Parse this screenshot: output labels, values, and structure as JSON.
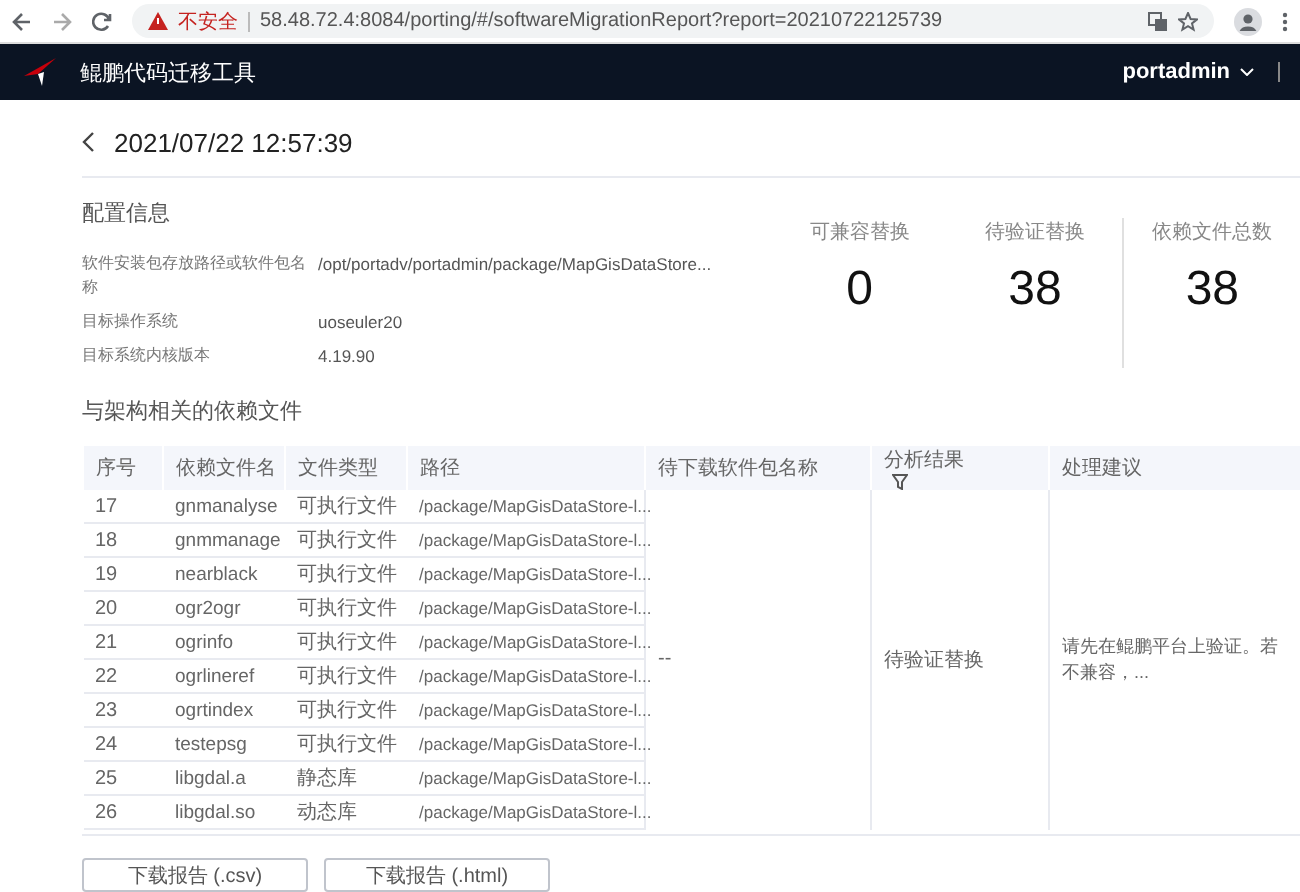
{
  "browser": {
    "security_label": "不安全",
    "url": "58.48.72.4:8084/porting/#/softwareMigrationReport?report=20210722125739"
  },
  "header": {
    "product_name": "鲲鹏代码迁移工具",
    "user": "portadmin"
  },
  "report": {
    "title": "2021/07/22 12:57:39"
  },
  "config": {
    "heading": "配置信息",
    "fields": [
      {
        "label": "软件安装包存放路径或软件包名称",
        "value": "/opt/portadv/portadmin/package/MapGisDataStore..."
      },
      {
        "label": "目标操作系统",
        "value": "uoseuler20"
      },
      {
        "label": "目标系统内核版本",
        "value": "4.19.90"
      }
    ]
  },
  "stats": [
    {
      "label": "可兼容替换",
      "value": "0"
    },
    {
      "label": "待验证替换",
      "value": "38"
    },
    {
      "label": "依赖文件总数",
      "value": "38"
    }
  ],
  "table": {
    "heading": "与架构相关的依赖文件",
    "columns": [
      "序号",
      "依赖文件名",
      "文件类型",
      "路径",
      "待下载软件包名称",
      "分析结果",
      "处理建议"
    ],
    "rows": [
      {
        "index": "17",
        "name": "gnmanalyse",
        "type": "可执行文件",
        "path": "/package/MapGisDataStore-l..."
      },
      {
        "index": "18",
        "name": "gnmmanage",
        "type": "可执行文件",
        "path": "/package/MapGisDataStore-l..."
      },
      {
        "index": "19",
        "name": "nearblack",
        "type": "可执行文件",
        "path": "/package/MapGisDataStore-l..."
      },
      {
        "index": "20",
        "name": "ogr2ogr",
        "type": "可执行文件",
        "path": "/package/MapGisDataStore-l..."
      },
      {
        "index": "21",
        "name": "ogrinfo",
        "type": "可执行文件",
        "path": "/package/MapGisDataStore-l..."
      },
      {
        "index": "22",
        "name": "ogrlineref",
        "type": "可执行文件",
        "path": "/package/MapGisDataStore-l..."
      },
      {
        "index": "23",
        "name": "ogrtindex",
        "type": "可执行文件",
        "path": "/package/MapGisDataStore-l..."
      },
      {
        "index": "24",
        "name": "testepsg",
        "type": "可执行文件",
        "path": "/package/MapGisDataStore-l..."
      },
      {
        "index": "25",
        "name": "libgdal.a",
        "type": "静态库",
        "path": "/package/MapGisDataStore-l..."
      },
      {
        "index": "26",
        "name": "libgdal.so",
        "type": "动态库",
        "path": "/package/MapGisDataStore-l..."
      }
    ],
    "pending_package": "--",
    "result": "待验证替换",
    "advice": "请先在鲲鹏平台上验证。若不兼容，..."
  },
  "buttons": [
    "下载报告 (.csv)",
    "下载报告 (.html)"
  ]
}
